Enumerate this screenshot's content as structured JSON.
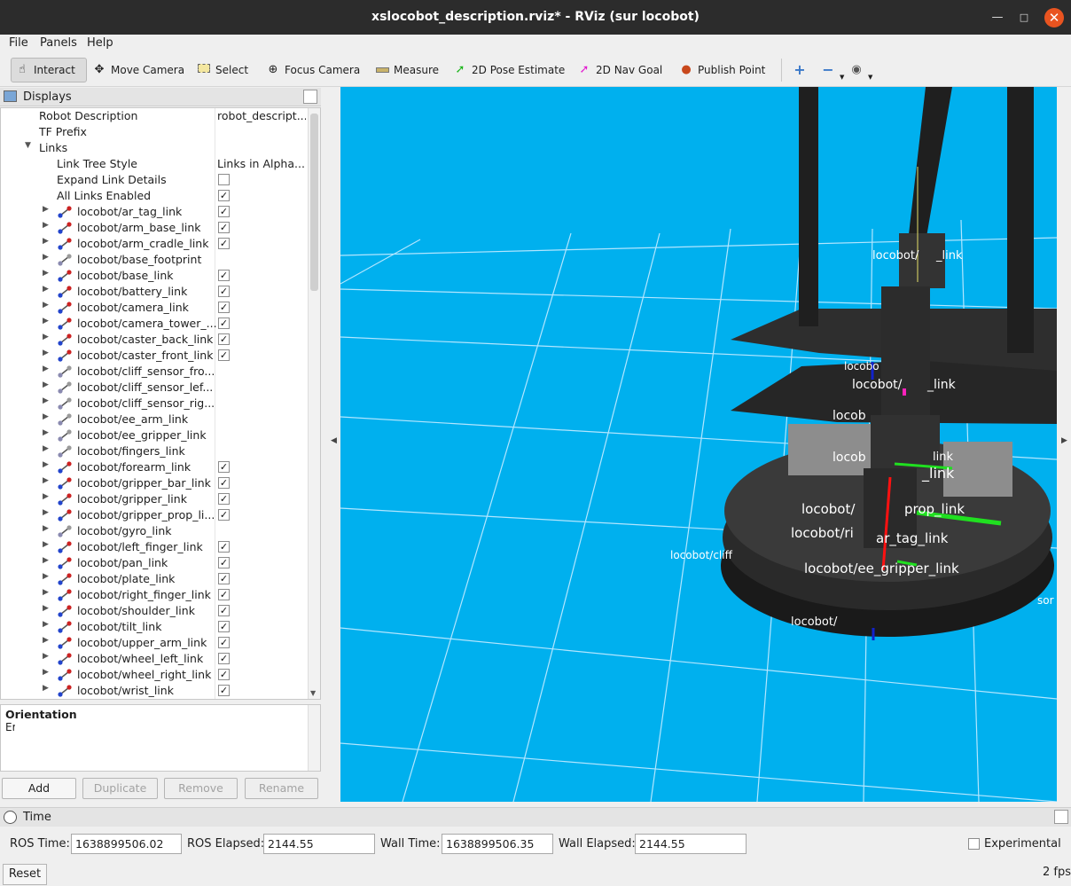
{
  "window": {
    "title": "xslocobot_description.rviz* - RViz (sur locobot)"
  },
  "menu": {
    "file": "File",
    "panels": "Panels",
    "help": "Help"
  },
  "toolbar": {
    "interact": "Interact",
    "move_camera": "Move Camera",
    "select": "Select",
    "focus_camera": "Focus Camera",
    "measure": "Measure",
    "pose_estimate": "2D Pose Estimate",
    "nav_goal": "2D Nav Goal",
    "publish_point": "Publish Point"
  },
  "displays": {
    "title": "Displays",
    "props": [
      {
        "label": "Robot Description",
        "value": "robot_descript..."
      },
      {
        "label": "TF Prefix",
        "value": ""
      },
      {
        "label": "Links",
        "value": ""
      },
      {
        "label": "Link Tree Style",
        "value": "Links in Alpha..."
      },
      {
        "label": "Expand Link Details",
        "value": ""
      },
      {
        "label": "All Links Enabled",
        "value": ""
      }
    ],
    "links": [
      {
        "name": "locobot/ar_tag_link",
        "checked": true
      },
      {
        "name": "locobot/arm_base_link",
        "checked": true
      },
      {
        "name": "locobot/arm_cradle_link",
        "checked": true
      },
      {
        "name": "locobot/base_footprint",
        "checked": false
      },
      {
        "name": "locobot/base_link",
        "checked": true
      },
      {
        "name": "locobot/battery_link",
        "checked": true
      },
      {
        "name": "locobot/camera_link",
        "checked": true
      },
      {
        "name": "locobot/camera_tower_...",
        "checked": true
      },
      {
        "name": "locobot/caster_back_link",
        "checked": true
      },
      {
        "name": "locobot/caster_front_link",
        "checked": true
      },
      {
        "name": "locobot/cliff_sensor_fro...",
        "checked": false
      },
      {
        "name": "locobot/cliff_sensor_lef...",
        "checked": false
      },
      {
        "name": "locobot/cliff_sensor_rig...",
        "checked": false
      },
      {
        "name": "locobot/ee_arm_link",
        "checked": false
      },
      {
        "name": "locobot/ee_gripper_link",
        "checked": false
      },
      {
        "name": "locobot/fingers_link",
        "checked": false
      },
      {
        "name": "locobot/forearm_link",
        "checked": true
      },
      {
        "name": "locobot/gripper_bar_link",
        "checked": true
      },
      {
        "name": "locobot/gripper_link",
        "checked": true
      },
      {
        "name": "locobot/gripper_prop_li...",
        "checked": true
      },
      {
        "name": "locobot/gyro_link",
        "checked": false
      },
      {
        "name": "locobot/left_finger_link",
        "checked": true
      },
      {
        "name": "locobot/pan_link",
        "checked": true
      },
      {
        "name": "locobot/plate_link",
        "checked": true
      },
      {
        "name": "locobot/right_finger_link",
        "checked": true
      },
      {
        "name": "locobot/shoulder_link",
        "checked": true
      },
      {
        "name": "locobot/tilt_link",
        "checked": true
      },
      {
        "name": "locobot/upper_arm_link",
        "checked": true
      },
      {
        "name": "locobot/wheel_left_link",
        "checked": true
      },
      {
        "name": "locobot/wheel_right_link",
        "checked": true
      },
      {
        "name": "locobot/wrist_link",
        "checked": true
      }
    ]
  },
  "description": {
    "title": "Orientation",
    "body": "Er"
  },
  "buttons": {
    "add": "Add",
    "duplicate": "Duplicate",
    "remove": "Remove",
    "rename": "Rename"
  },
  "viewport": {
    "labels": [
      "locobot/",
      "_link",
      "locobo",
      "locobot/",
      "_link",
      "locob",
      "link",
      "locob",
      "_link",
      "locobot/",
      "prop_link",
      "locobot/ri",
      "ar_tag_link",
      "locobot/ee_gripper_link",
      "locobot/cliff",
      "locobot/",
      "sor"
    ]
  },
  "time": {
    "title": "Time",
    "ros_time_label": "ROS Time:",
    "ros_time": "1638899506.02",
    "ros_elapsed_label": "ROS Elapsed:",
    "ros_elapsed": "2144.55",
    "wall_time_label": "Wall Time:",
    "wall_time": "1638899506.35",
    "wall_elapsed_label": "Wall Elapsed:",
    "wall_elapsed": "2144.55",
    "experimental": "Experimental",
    "reset": "Reset",
    "fps": "2 fps"
  }
}
